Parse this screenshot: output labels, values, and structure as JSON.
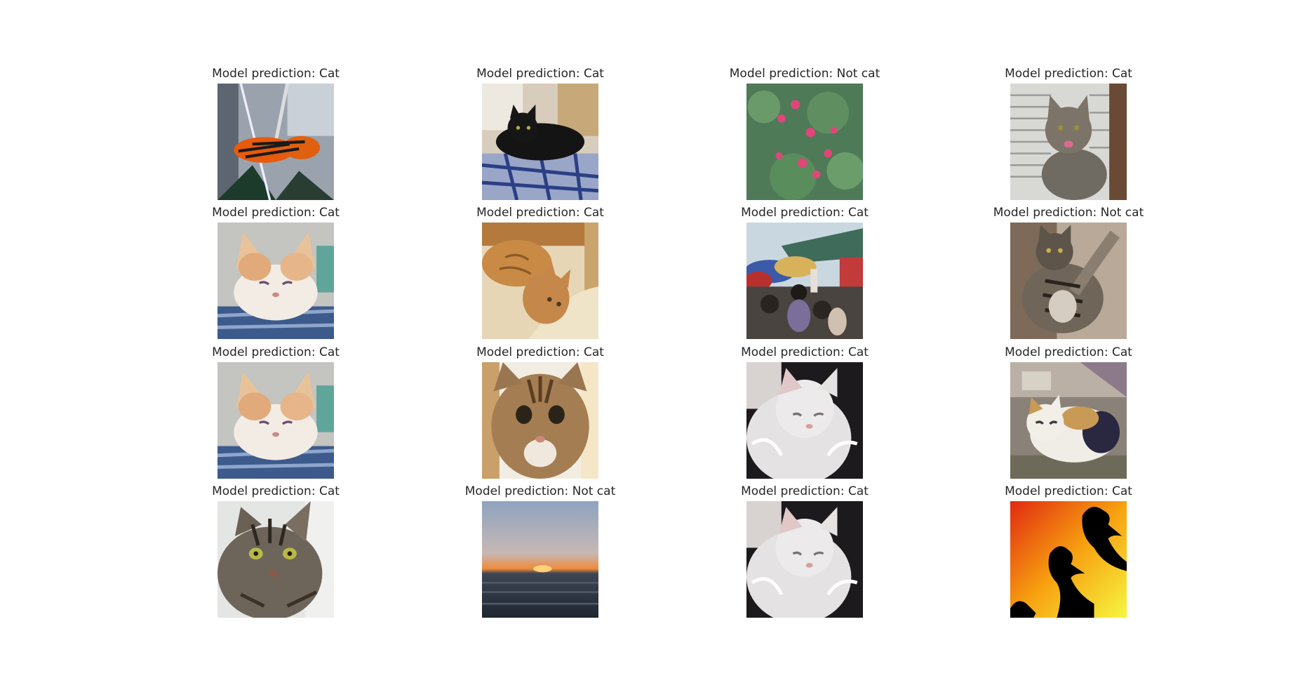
{
  "figure": {
    "grid": {
      "rows": 4,
      "cols": 4,
      "cells": [
        {
          "label": "Model prediction: Cat",
          "subject": "butterfly-image"
        },
        {
          "label": "Model prediction: Cat",
          "subject": "black-cat-image"
        },
        {
          "label": "Model prediction: Not cat",
          "subject": "pink-flowers-image"
        },
        {
          "label": "Model prediction: Cat",
          "subject": "tabby-cat-window-image"
        },
        {
          "label": "Model prediction: Cat",
          "subject": "orange-white-kitten-image"
        },
        {
          "label": "Model prediction: Cat",
          "subject": "orange-cat-pillow-image"
        },
        {
          "label": "Model prediction: Cat",
          "subject": "market-crowd-image"
        },
        {
          "label": "Model prediction: Not cat",
          "subject": "fluffy-tabby-cat-image"
        },
        {
          "label": "Model prediction: Cat",
          "subject": "orange-white-kitten-image"
        },
        {
          "label": "Model prediction: Cat",
          "subject": "cat-face-closeup-image"
        },
        {
          "label": "Model prediction: Cat",
          "subject": "white-fluffy-cat-image"
        },
        {
          "label": "Model prediction: Cat",
          "subject": "calico-cat-image"
        },
        {
          "label": "Model prediction: Cat",
          "subject": "tabby-cat-portrait-image"
        },
        {
          "label": "Model prediction: Not cat",
          "subject": "sea-sunset-image"
        },
        {
          "label": "Model prediction: Cat",
          "subject": "white-fluffy-cat-image"
        },
        {
          "label": "Model prediction: Cat",
          "subject": "birds-silhouette-image"
        }
      ]
    }
  }
}
